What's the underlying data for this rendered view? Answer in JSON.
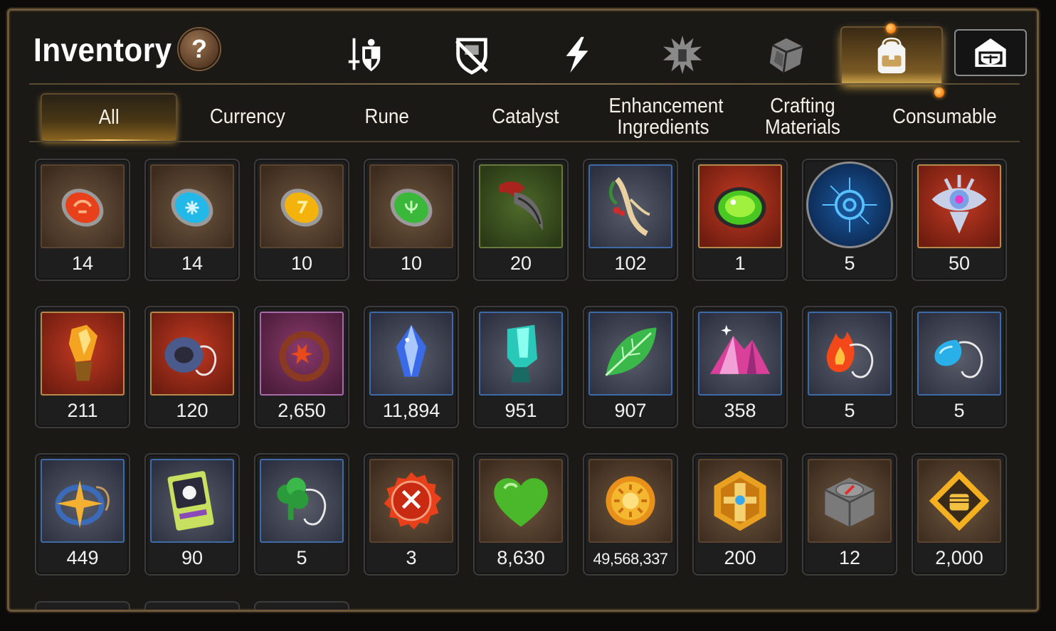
{
  "header": {
    "title": "Inventory",
    "help_icon": "?"
  },
  "top_icons": [
    {
      "icon": "sword-shield-icon"
    },
    {
      "icon": "crossed-shield-icon"
    },
    {
      "icon": "lightning-icon"
    },
    {
      "icon": "burst-emblem-icon"
    },
    {
      "icon": "cube-icon"
    },
    {
      "icon": "backpack-icon",
      "active": true
    },
    {
      "icon": "vault-icon"
    }
  ],
  "tabs": [
    "All",
    "Currency",
    "Rune",
    "Catalyst",
    "Enhancement Ingredients",
    "Crafting Materials",
    "Consumable"
  ],
  "active_tab": "All",
  "items": [
    {
      "icon": "red-rune-icon",
      "qty": "14"
    },
    {
      "icon": "blue-rune-icon",
      "qty": "14"
    },
    {
      "icon": "yellow-rune-icon",
      "qty": "10"
    },
    {
      "icon": "green-rune-icon",
      "qty": "10"
    },
    {
      "icon": "claw-icon",
      "qty": "20"
    },
    {
      "icon": "root-herb-icon",
      "qty": "102"
    },
    {
      "icon": "green-orb-icon",
      "qty": "1"
    },
    {
      "icon": "blue-seal-icon",
      "qty": "5"
    },
    {
      "icon": "eye-emblem-icon",
      "qty": "50"
    },
    {
      "icon": "gold-crystal-icon",
      "qty": "211"
    },
    {
      "icon": "ring-pendant-icon",
      "qty": "120"
    },
    {
      "icon": "flower-ring-icon",
      "qty": "2,650"
    },
    {
      "icon": "blue-gem-icon",
      "qty": "11,894"
    },
    {
      "icon": "teal-crystal-icon",
      "qty": "951"
    },
    {
      "icon": "leaf-icon",
      "qty": "907"
    },
    {
      "icon": "pink-mountain-icon",
      "qty": "358"
    },
    {
      "icon": "fire-pendant-icon",
      "qty": "5"
    },
    {
      "icon": "water-pendant-icon",
      "qty": "5"
    },
    {
      "icon": "star-pendant-icon",
      "qty": "449"
    },
    {
      "icon": "card-icon",
      "qty": "90"
    },
    {
      "icon": "tree-pendant-icon",
      "qty": "5"
    },
    {
      "icon": "red-badge-icon",
      "qty": "3"
    },
    {
      "icon": "heart-icon",
      "qty": "8,630"
    },
    {
      "icon": "gold-coin-icon",
      "qty": "49,568,337"
    },
    {
      "icon": "gold-hexagon-icon",
      "qty": "200"
    },
    {
      "icon": "compass-stone-icon",
      "qty": "12"
    },
    {
      "icon": "fist-emblem-icon",
      "qty": "2,000"
    }
  ]
}
